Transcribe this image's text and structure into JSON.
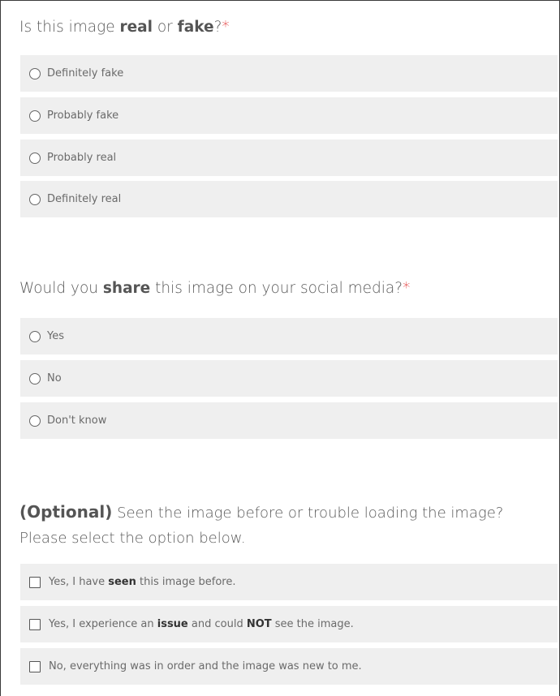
{
  "q1": {
    "pre": "Is this image ",
    "bold1": "real",
    "mid": " or ",
    "bold2": "fake",
    "post": "?",
    "required": "*",
    "options": [
      "Definitely fake",
      "Probably fake",
      "Probably real",
      "Definitely real"
    ]
  },
  "q2": {
    "pre": "Would you ",
    "bold": "share",
    "post": " this image on your social media?",
    "required": "*",
    "options": [
      "Yes",
      "No",
      "Don't know"
    ]
  },
  "q3": {
    "bold": "(Optional)",
    "line1": " Seen the image before or trouble loading the image?",
    "line2": "Please select the option below.",
    "options": [
      {
        "pre": "Yes, I have ",
        "bold": "seen",
        "post": " this image before."
      },
      {
        "pre": "Yes, I experience an ",
        "bold": "issue",
        "mid": " and could ",
        "bold2": "NOT",
        "post": " see the image."
      },
      {
        "pre": "No, everything was in order and the image was new to me."
      }
    ]
  }
}
